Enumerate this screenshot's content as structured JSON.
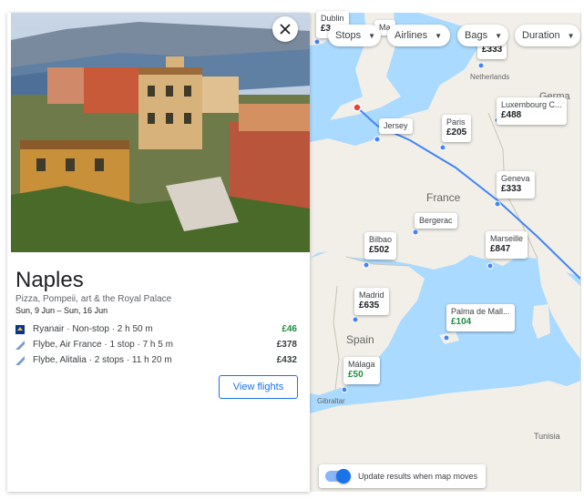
{
  "destination": {
    "city": "Naples",
    "tagline": "Pizza, Pompeii, art & the Royal Palace",
    "dates": "Sun, 9 Jun – Sun, 16 Jun"
  },
  "flights": [
    {
      "airline": "Ryanair · Non-stop · 2 h 50 m",
      "price": "£46",
      "cheap": true
    },
    {
      "airline": "Flybe, Air France · 1 stop · 7 h 5 m",
      "price": "£378",
      "cheap": false
    },
    {
      "airline": "Flybe, Alitalia · 2 stops · 11 h 20 m",
      "price": "£432",
      "cheap": false
    }
  ],
  "view_flights_label": "View flights",
  "filters": {
    "stops": "Stops",
    "airlines": "Airlines",
    "bags": "Bags",
    "duration": "Duration"
  },
  "map_labels": {
    "france": "France",
    "spain": "Spain",
    "netherlands": "Netherlands",
    "tunisia": "Tunisia",
    "gibraltar": "Gibraltar",
    "germany_partial": "Germa"
  },
  "destinations": [
    {
      "key": "dublin",
      "name": "Dublin",
      "price": "£3"
    },
    {
      "key": "ma",
      "name": "Ma",
      "price": ""
    },
    {
      "key": "ams",
      "name": "",
      "price": "£333"
    },
    {
      "key": "lux",
      "name": "Luxembourg C...",
      "price": "£488"
    },
    {
      "key": "jersey",
      "name": "Jersey",
      "price": ""
    },
    {
      "key": "paris",
      "name": "Paris",
      "price": "£205"
    },
    {
      "key": "geneva",
      "name": "Geneva",
      "price": "£333"
    },
    {
      "key": "bergerac",
      "name": "Bergerac",
      "price": ""
    },
    {
      "key": "bilbao",
      "name": "Bilbao",
      "price": "£502"
    },
    {
      "key": "marseille",
      "name": "Marseille",
      "price": "£847"
    },
    {
      "key": "madrid",
      "name": "Madrid",
      "price": "£635"
    },
    {
      "key": "palma",
      "name": "Palma de Mall...",
      "price": "£104",
      "cheap": true
    },
    {
      "key": "malaga",
      "name": "Málaga",
      "price": "£50",
      "cheap": true
    }
  ],
  "toggle": {
    "label": "Update results when map moves",
    "on": true
  },
  "colors": {
    "accent": "#1a73e8",
    "cheap": "#1e8e3e",
    "water": "#aadaff",
    "land": "#f1efe8"
  },
  "icons": {
    "close": "close-icon",
    "caret": "chevron-down-icon",
    "airline": "airline-logo-icon"
  }
}
